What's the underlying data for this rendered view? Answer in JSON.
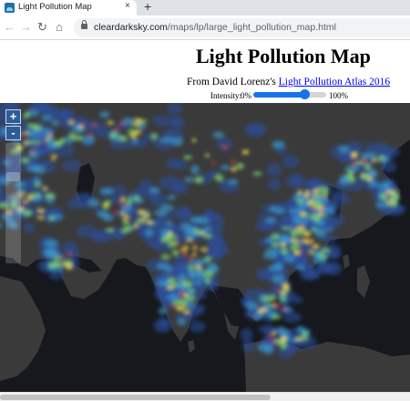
{
  "browser": {
    "tab_title": "Light Pollution Map",
    "tab_close": "×",
    "new_tab": "+",
    "url_host": "cleardarksky.com",
    "url_path": "/maps/lp/large_light_pollution_map.html",
    "icons": [
      "back-arrow-icon",
      "forward-arrow-icon",
      "reload-icon",
      "home-icon",
      "lock-icon"
    ]
  },
  "page": {
    "title": "Light Pollution Map",
    "credit_prefix": "From David Lorenz's ",
    "credit_link": "Light Pollution Atlas 2016",
    "intensity": {
      "label": "Intensity:",
      "min_label": "0%",
      "max_label": "100%",
      "value_fraction": 0.7
    }
  },
  "map": {
    "controls": {
      "zoom_in": "+",
      "zoom_out": "-",
      "zoom_level_fraction": 0.27
    },
    "colors": {
      "ocean": "#16181d",
      "land": "#3a3a3b",
      "light_low": "#2c4f9c",
      "light_mid": "#3a9ad0",
      "light_high": "#7fd36b",
      "light_very_high": "#f0e24a",
      "light_extreme": "#e8452c"
    }
  },
  "scrollbar": {
    "thumb_fraction": 0.66
  }
}
